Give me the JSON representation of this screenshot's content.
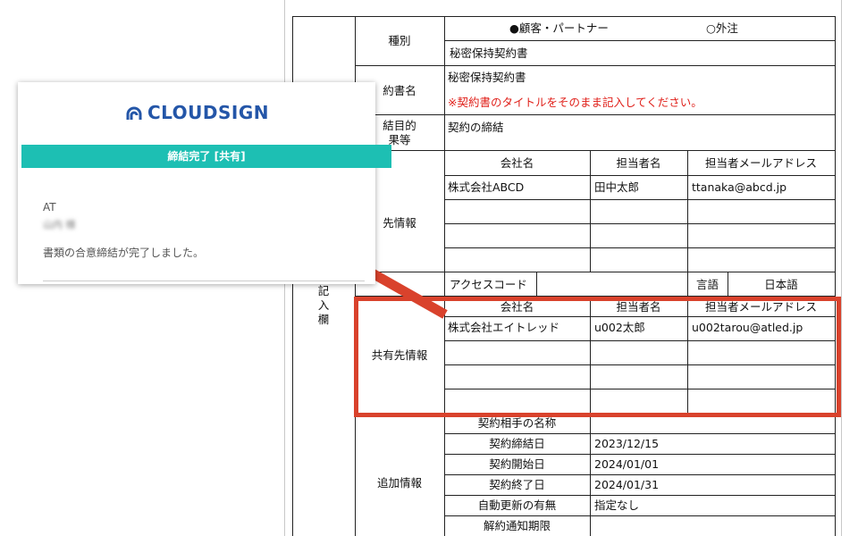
{
  "popup": {
    "logo_text": "CLOUDSIGN",
    "banner": "締結完了 [共有]",
    "recipient_initials": "AT",
    "recipient_name_blurred": "山内 様",
    "message": "書類の合意締結が完了しました。",
    "colors": {
      "banner": "#1dbfb3",
      "logo": "#2456a8"
    }
  },
  "form": {
    "row_type": {
      "label": "種別",
      "option_customer": "●顧客・パートナー",
      "option_outsource": "○外注",
      "value": "秘密保持契約書"
    },
    "row_contract_name": {
      "label": "約書名",
      "value": "秘密保持契約書",
      "note": "※契約書のタイトルをそのまま記入してください。"
    },
    "row_purpose": {
      "label_line1": "結目的",
      "label_line2": "果等",
      "value": "契約の締結"
    },
    "partner": {
      "label": "先情報",
      "headers": [
        "会社名",
        "担当者名",
        "担当者メールアドレス"
      ],
      "rows": [
        [
          "株式会社ABCD",
          "田中太郎",
          "ttanaka@abcd.jp"
        ],
        [
          "",
          "",
          ""
        ],
        [
          "",
          "",
          ""
        ],
        [
          "",
          "",
          ""
        ]
      ],
      "access_code_label": "アクセスコード",
      "language_label": "言語",
      "language_value": "日本語"
    },
    "section_label": [
      "記",
      "入",
      "欄"
    ],
    "share": {
      "label": "共有先情報",
      "headers": [
        "会社名",
        "担当者名",
        "担当者メールアドレス"
      ],
      "rows": [
        [
          "株式会社エイトレッド",
          "u002太郎",
          "u002tarou@atled.jp"
        ],
        [
          "",
          "",
          ""
        ],
        [
          "",
          "",
          ""
        ],
        [
          "",
          "",
          ""
        ]
      ]
    },
    "additional": {
      "label": "追加情報",
      "rows": [
        {
          "label": "契約相手の名称",
          "value": ""
        },
        {
          "label": "契約締結日",
          "value": "2023/12/15"
        },
        {
          "label": "契約開始日",
          "value": "2024/01/01"
        },
        {
          "label": "契約終了日",
          "value": "2024/01/31"
        },
        {
          "label": "自動更新の有無",
          "value": "指定なし"
        },
        {
          "label": "解約通知期限",
          "value": ""
        }
      ]
    }
  },
  "highlight_color": "#d9422c"
}
